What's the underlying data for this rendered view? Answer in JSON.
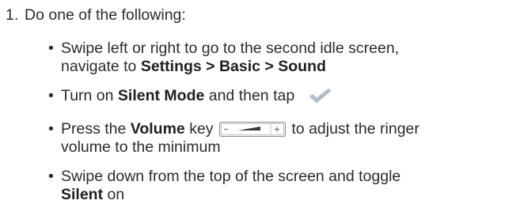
{
  "step": {
    "number": "1.",
    "text": "Do one of the following:"
  },
  "bullets": [
    {
      "marker": "•",
      "part1": "Swipe left or right to go to the second idle screen,",
      "part2": "navigate to ",
      "bold": "Settings > Basic > Sound"
    },
    {
      "marker": "•",
      "part1": "Turn on ",
      "bold": "Silent Mode",
      "part2": " and then tap",
      "icon": "checkmark-icon"
    },
    {
      "marker": "•",
      "part1": "Press the ",
      "bold": "Volume",
      "part2": " key",
      "icon": "volume-key-icon",
      "part3": " to adjust the ringer",
      "part4": "volume to the minimum"
    },
    {
      "marker": "•",
      "part1": "Swipe down from the top of the screen and toggle",
      "bold": "Silent",
      "part2": " on"
    }
  ]
}
